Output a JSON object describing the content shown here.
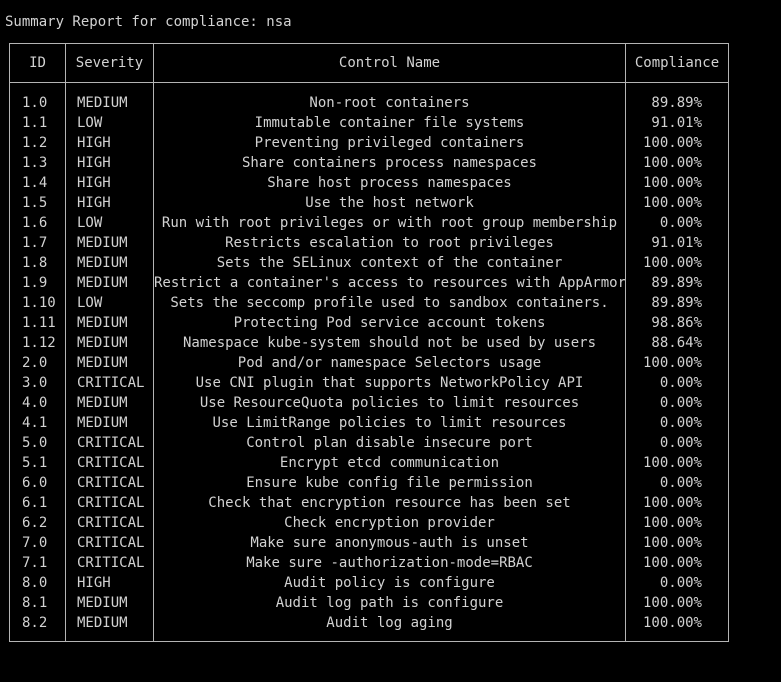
{
  "title": "Summary Report for compliance: nsa",
  "headers": {
    "id": "ID",
    "severity": "Severity",
    "control_name": "Control Name",
    "compliance": "Compliance"
  },
  "rows": [
    {
      "id": "1.0",
      "severity": "MEDIUM",
      "name": "Non-root containers",
      "compliance": "89.89%"
    },
    {
      "id": "1.1",
      "severity": "LOW",
      "name": "Immutable container file systems",
      "compliance": "91.01%"
    },
    {
      "id": "1.2",
      "severity": "HIGH",
      "name": "Preventing privileged containers",
      "compliance": "100.00%"
    },
    {
      "id": "1.3",
      "severity": "HIGH",
      "name": "Share containers process namespaces",
      "compliance": "100.00%"
    },
    {
      "id": "1.4",
      "severity": "HIGH",
      "name": "Share host process namespaces",
      "compliance": "100.00%"
    },
    {
      "id": "1.5",
      "severity": "HIGH",
      "name": "Use the host network",
      "compliance": "100.00%"
    },
    {
      "id": "1.6",
      "severity": "LOW",
      "name": "Run with root privileges or with root group membership",
      "compliance": "0.00%"
    },
    {
      "id": "1.7",
      "severity": "MEDIUM",
      "name": "Restricts escalation to root privileges",
      "compliance": "91.01%"
    },
    {
      "id": "1.8",
      "severity": "MEDIUM",
      "name": "Sets the SELinux context of the container",
      "compliance": "100.00%"
    },
    {
      "id": "1.9",
      "severity": "MEDIUM",
      "name": "Restrict a container's access to resources with AppArmor",
      "compliance": "89.89%"
    },
    {
      "id": "1.10",
      "severity": "LOW",
      "name": "Sets the seccomp profile used to sandbox containers.",
      "compliance": "89.89%"
    },
    {
      "id": "1.11",
      "severity": "MEDIUM",
      "name": "Protecting Pod service account tokens",
      "compliance": "98.86%"
    },
    {
      "id": "1.12",
      "severity": "MEDIUM",
      "name": "Namespace kube-system should not be used by users",
      "compliance": "88.64%"
    },
    {
      "id": "2.0",
      "severity": "MEDIUM",
      "name": "Pod and/or namespace Selectors usage",
      "compliance": "100.00%"
    },
    {
      "id": "3.0",
      "severity": "CRITICAL",
      "name": "Use CNI plugin that supports NetworkPolicy API",
      "compliance": "0.00%"
    },
    {
      "id": "4.0",
      "severity": "MEDIUM",
      "name": "Use ResourceQuota policies to limit resources",
      "compliance": "0.00%"
    },
    {
      "id": "4.1",
      "severity": "MEDIUM",
      "name": "Use LimitRange policies to limit resources",
      "compliance": "0.00%"
    },
    {
      "id": "5.0",
      "severity": "CRITICAL",
      "name": "Control plan disable insecure port",
      "compliance": "0.00%"
    },
    {
      "id": "5.1",
      "severity": "CRITICAL",
      "name": "Encrypt etcd communication",
      "compliance": "100.00%"
    },
    {
      "id": "6.0",
      "severity": "CRITICAL",
      "name": "Ensure kube config file permission",
      "compliance": "0.00%"
    },
    {
      "id": "6.1",
      "severity": "CRITICAL",
      "name": "Check that encryption resource has been set",
      "compliance": "100.00%"
    },
    {
      "id": "6.2",
      "severity": "CRITICAL",
      "name": "Check encryption provider",
      "compliance": "100.00%"
    },
    {
      "id": "7.0",
      "severity": "CRITICAL",
      "name": "Make sure anonymous-auth is unset",
      "compliance": "100.00%"
    },
    {
      "id": "7.1",
      "severity": "CRITICAL",
      "name": "Make sure -authorization-mode=RBAC",
      "compliance": "100.00%"
    },
    {
      "id": "8.0",
      "severity": "HIGH",
      "name": "Audit policy is configure",
      "compliance": "0.00%"
    },
    {
      "id": "8.1",
      "severity": "MEDIUM",
      "name": "Audit log path is configure",
      "compliance": "100.00%"
    },
    {
      "id": "8.2",
      "severity": "MEDIUM",
      "name": "Audit log aging",
      "compliance": "100.00%"
    }
  ],
  "colors": {
    "background": "#000000",
    "text": "#d2d2d2",
    "border": "#b4b4b4"
  }
}
